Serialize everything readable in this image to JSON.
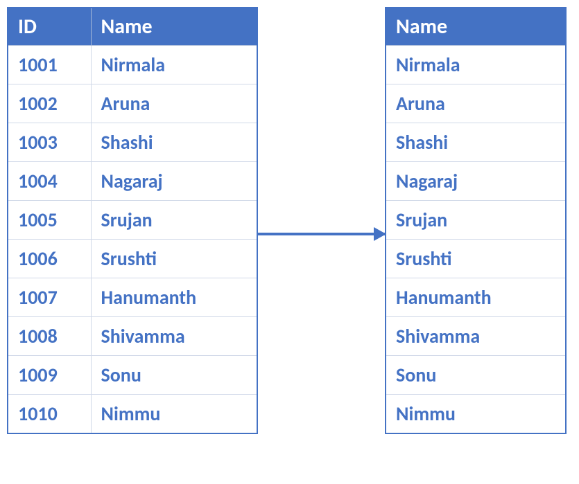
{
  "left_table": {
    "headers": [
      "ID",
      "Name"
    ],
    "rows": [
      {
        "id": "1001",
        "name": "Nirmala"
      },
      {
        "id": "1002",
        "name": "Aruna"
      },
      {
        "id": "1003",
        "name": "Shashi"
      },
      {
        "id": "1004",
        "name": "Nagaraj"
      },
      {
        "id": "1005",
        "name": "Srujan"
      },
      {
        "id": "1006",
        "name": "Srushti"
      },
      {
        "id": "1007",
        "name": "Hanumanth"
      },
      {
        "id": "1008",
        "name": "Shivamma"
      },
      {
        "id": "1009",
        "name": "Sonu"
      },
      {
        "id": "1010",
        "name": "Nimmu"
      }
    ]
  },
  "right_table": {
    "headers": [
      "Name"
    ],
    "rows": [
      {
        "name": "Nirmala"
      },
      {
        "name": "Aruna"
      },
      {
        "name": "Shashi"
      },
      {
        "name": "Nagaraj"
      },
      {
        "name": "Srujan"
      },
      {
        "name": "Srushti"
      },
      {
        "name": "Hanumanth"
      },
      {
        "name": "Shivamma"
      },
      {
        "name": "Sonu"
      },
      {
        "name": "Nimmu"
      }
    ]
  }
}
